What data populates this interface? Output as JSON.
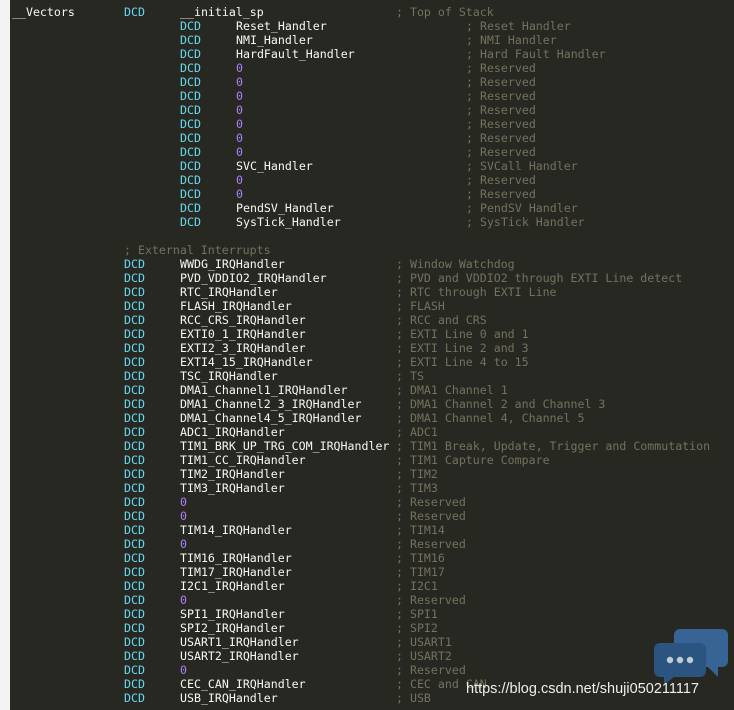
{
  "colors": {
    "background": "#272822",
    "label": "#f8f8f2",
    "directive": "#66d9ef",
    "symbol": "#f8f8f2",
    "number": "#ae81ff",
    "comment": "#75715e",
    "watermark": "#ffffff",
    "icon": "#3a6fa8"
  },
  "lines": [
    {
      "label": "__Vectors",
      "dcd": "DCD",
      "symbol": "__initial_sp",
      "comment": "; Top of Stack"
    },
    {
      "dcd": "DCD",
      "symbol": "Reset_Handler",
      "comment": "; Reset Handler"
    },
    {
      "dcd": "DCD",
      "symbol": "NMI_Handler",
      "comment": "; NMI Handler"
    },
    {
      "dcd": "DCD",
      "symbol": "HardFault_Handler",
      "comment": "; Hard Fault Handler"
    },
    {
      "dcd": "DCD",
      "number": "0",
      "comment": "; Reserved"
    },
    {
      "dcd": "DCD",
      "number": "0",
      "comment": "; Reserved"
    },
    {
      "dcd": "DCD",
      "number": "0",
      "comment": "; Reserved"
    },
    {
      "dcd": "DCD",
      "number": "0",
      "comment": "; Reserved"
    },
    {
      "dcd": "DCD",
      "number": "0",
      "comment": "; Reserved"
    },
    {
      "dcd": "DCD",
      "number": "0",
      "comment": "; Reserved"
    },
    {
      "dcd": "DCD",
      "number": "0",
      "comment": "; Reserved"
    },
    {
      "dcd": "DCD",
      "symbol": "SVC_Handler",
      "comment": "; SVCall Handler"
    },
    {
      "dcd": "DCD",
      "number": "0",
      "comment": "; Reserved"
    },
    {
      "dcd": "DCD",
      "number": "0",
      "comment": "; Reserved"
    },
    {
      "dcd": "DCD",
      "symbol": "PendSV_Handler",
      "comment": "; PendSV Handler"
    },
    {
      "dcd": "DCD",
      "symbol": "SysTick_Handler",
      "comment": "; SysTick Handler"
    },
    {},
    {
      "section_comment": "; External Interrupts"
    },
    {
      "dcd": "DCD",
      "symbol": "WWDG_IRQHandler",
      "comment": "; Window Watchdog"
    },
    {
      "dcd": "DCD",
      "symbol": "PVD_VDDIO2_IRQHandler",
      "comment": "; PVD and VDDIO2 through EXTI Line detect"
    },
    {
      "dcd": "DCD",
      "symbol": "RTC_IRQHandler",
      "comment": "; RTC through EXTI Line"
    },
    {
      "dcd": "DCD",
      "symbol": "FLASH_IRQHandler",
      "comment": "; FLASH"
    },
    {
      "dcd": "DCD",
      "symbol": "RCC_CRS_IRQHandler",
      "comment": "; RCC and CRS"
    },
    {
      "dcd": "DCD",
      "symbol": "EXTI0_1_IRQHandler",
      "comment": "; EXTI Line 0 and 1"
    },
    {
      "dcd": "DCD",
      "symbol": "EXTI2_3_IRQHandler",
      "comment": "; EXTI Line 2 and 3"
    },
    {
      "dcd": "DCD",
      "symbol": "EXTI4_15_IRQHandler",
      "comment": "; EXTI Line 4 to 15"
    },
    {
      "dcd": "DCD",
      "symbol": "TSC_IRQHandler",
      "comment": "; TS"
    },
    {
      "dcd": "DCD",
      "symbol": "DMA1_Channel1_IRQHandler",
      "comment": "; DMA1 Channel 1"
    },
    {
      "dcd": "DCD",
      "symbol": "DMA1_Channel2_3_IRQHandler",
      "comment": "; DMA1 Channel 2 and Channel 3"
    },
    {
      "dcd": "DCD",
      "symbol": "DMA1_Channel4_5_IRQHandler",
      "comment": "; DMA1 Channel 4, Channel 5"
    },
    {
      "dcd": "DCD",
      "symbol": "ADC1_IRQHandler",
      "comment": "; ADC1"
    },
    {
      "dcd": "DCD",
      "symbol": "TIM1_BRK_UP_TRG_COM_IRQHandler",
      "comment": "; TIM1 Break, Update, Trigger and Commutation"
    },
    {
      "dcd": "DCD",
      "symbol": "TIM1_CC_IRQHandler",
      "comment": "; TIM1 Capture Compare"
    },
    {
      "dcd": "DCD",
      "symbol": "TIM2_IRQHandler",
      "comment": "; TIM2"
    },
    {
      "dcd": "DCD",
      "symbol": "TIM3_IRQHandler",
      "comment": "; TIM3"
    },
    {
      "dcd": "DCD",
      "number": "0",
      "comment": "; Reserved"
    },
    {
      "dcd": "DCD",
      "number": "0",
      "comment": "; Reserved"
    },
    {
      "dcd": "DCD",
      "symbol": "TIM14_IRQHandler",
      "comment": "; TIM14"
    },
    {
      "dcd": "DCD",
      "number": "0",
      "comment": "; Reserved"
    },
    {
      "dcd": "DCD",
      "symbol": "TIM16_IRQHandler",
      "comment": "; TIM16"
    },
    {
      "dcd": "DCD",
      "symbol": "TIM17_IRQHandler",
      "comment": "; TIM17"
    },
    {
      "dcd": "DCD",
      "symbol": "I2C1_IRQHandler",
      "comment": "; I2C1"
    },
    {
      "dcd": "DCD",
      "number": "0",
      "comment": "; Reserved"
    },
    {
      "dcd": "DCD",
      "symbol": "SPI1_IRQHandler",
      "comment": "; SPI1"
    },
    {
      "dcd": "DCD",
      "symbol": "SPI2_IRQHandler",
      "comment": "; SPI2"
    },
    {
      "dcd": "DCD",
      "symbol": "USART1_IRQHandler",
      "comment": "; USART1"
    },
    {
      "dcd": "DCD",
      "symbol": "USART2_IRQHandler",
      "comment": "; USART2"
    },
    {
      "dcd": "DCD",
      "number": "0",
      "comment": "; Reserved"
    },
    {
      "dcd": "DCD",
      "symbol": "CEC_CAN_IRQHandler",
      "comment": "; CEC and CAN"
    },
    {
      "dcd": "DCD",
      "symbol": "USB_IRQHandler",
      "comment": "; USB"
    }
  ],
  "watermark": {
    "text": "https://blog.csdn.net/shuji050211117",
    "icon": "chat-bubble-icon"
  }
}
